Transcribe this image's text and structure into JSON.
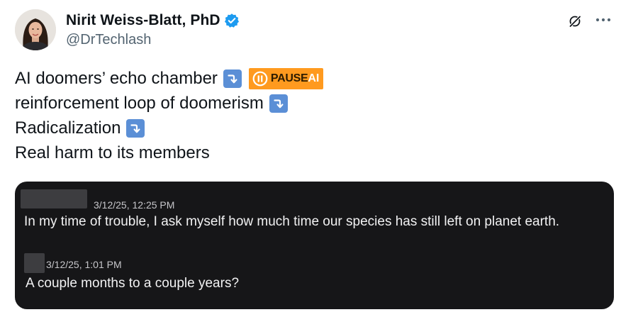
{
  "author": {
    "display_name": "Nirit Weiss-Blatt, PhD",
    "handle": "@DrTechlash",
    "avatar_icon": "profile-photo",
    "verified_icon": "verified-badge-icon",
    "verified_color": "#1d9bf0"
  },
  "header_actions": {
    "grok_icon": "grok-icon",
    "more_icon": "more-horizontal-icon"
  },
  "tweet": {
    "lines": [
      {
        "text": "AI doomers’ echo chamber",
        "emoji": "right-arrow-curving-down"
      },
      {
        "text": "reinforcement loop of doomerism",
        "emoji": "right-arrow-curving-down"
      },
      {
        "text": "Radicalization",
        "emoji": "right-arrow-curving-down"
      },
      {
        "text": "Real harm to its members"
      }
    ],
    "badge": {
      "word": "PAUSE",
      "suffix": "AI",
      "color": "#ff9a1f",
      "icon": "pause-circle-icon"
    }
  },
  "media": {
    "background": "#161618",
    "messages": [
      {
        "timestamp": "3/12/25, 12:25 PM",
        "text": "In my time of trouble, I ask myself how much time our species has still left on planet earth."
      },
      {
        "timestamp": "3/12/25, 1:01 PM",
        "text": "A couple months to a couple years?"
      }
    ]
  }
}
